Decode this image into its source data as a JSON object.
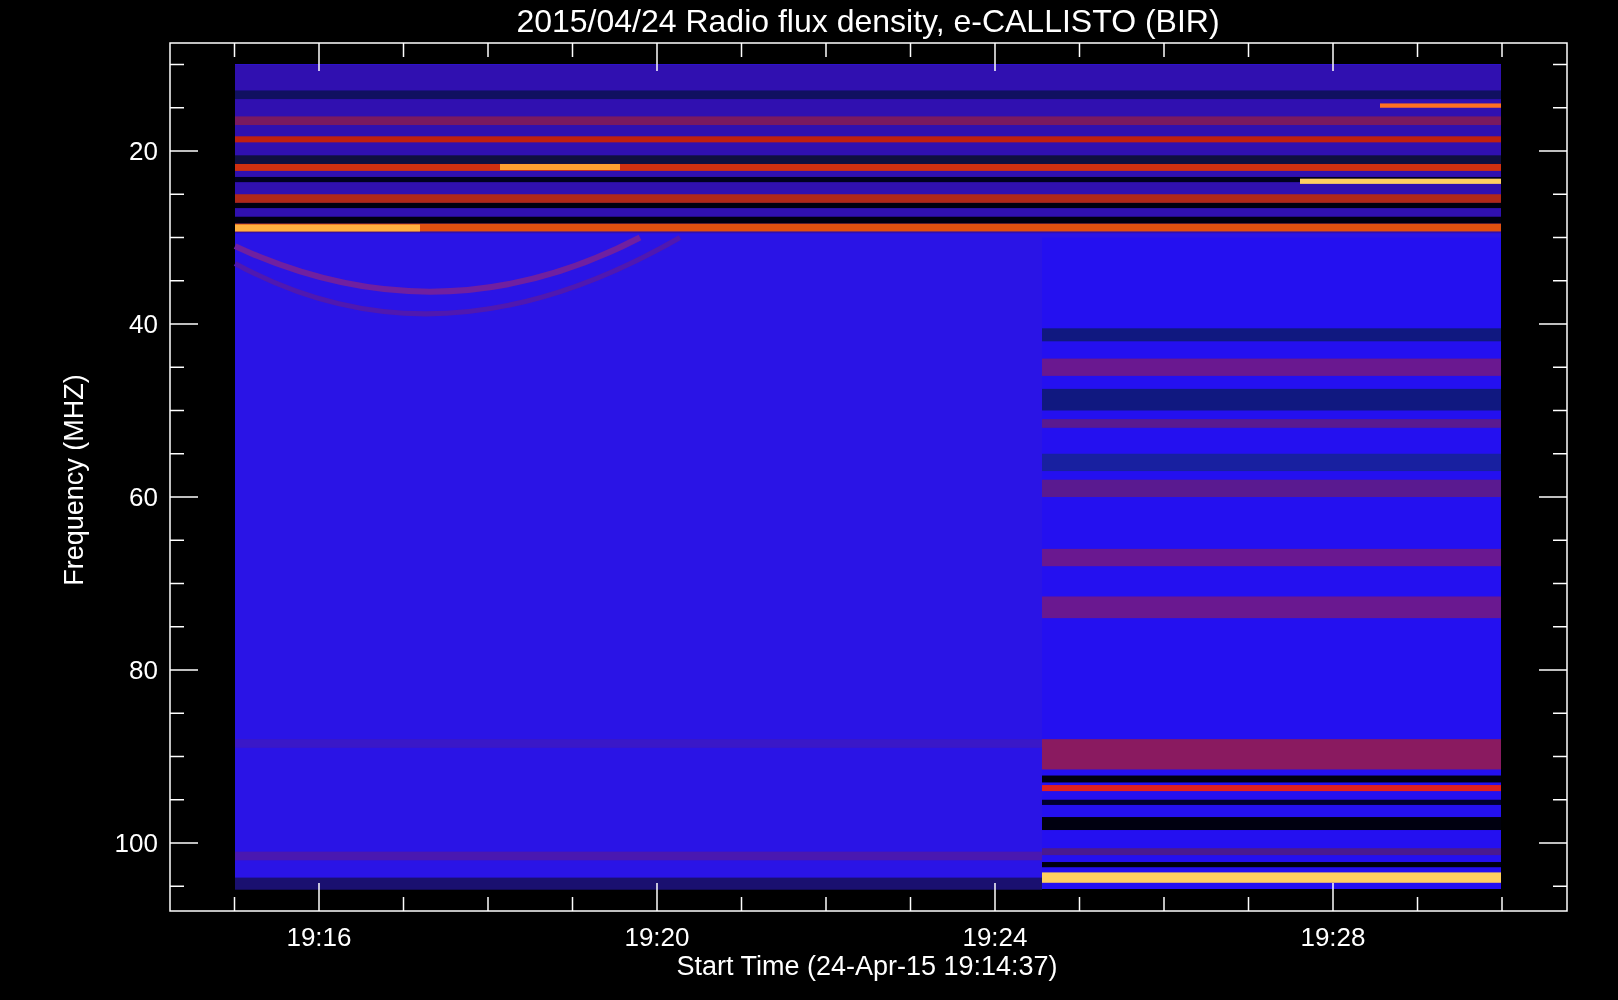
{
  "title": "2015/04/24  Radio flux density, e-CALLISTO (BIR)",
  "y_axis": {
    "label": "Frequency (MHZ)",
    "ticks": [
      "20",
      "40",
      "60",
      "80",
      "100"
    ]
  },
  "x_axis": {
    "label": "Start Time (24-Apr-15 19:14:37)",
    "ticks": [
      "19:16",
      "19:20",
      "19:24",
      "19:28"
    ]
  }
}
